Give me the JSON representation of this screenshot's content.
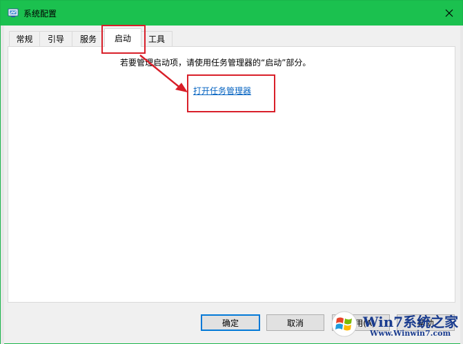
{
  "window": {
    "title": "系统配置"
  },
  "tabs": [
    {
      "label": "常规"
    },
    {
      "label": "引导"
    },
    {
      "label": "服务"
    },
    {
      "label": "启动"
    },
    {
      "label": "工具"
    }
  ],
  "active_tab": "启动",
  "startup": {
    "hint": "若要管理启动项，请使用任务管理器的“启动”部分。",
    "link_text": "打开任务管理器"
  },
  "buttons": {
    "ok": "确定",
    "cancel": "取消",
    "apply": "应用(A)",
    "help": "帮助"
  },
  "watermark": {
    "brand": "Win7系统之家",
    "url": "Www.Winwin7.com"
  },
  "colors": {
    "titlebar": "#1bc14f",
    "annotation": "#d81e28",
    "link": "#0563c1",
    "focus_border": "#0078d7"
  }
}
